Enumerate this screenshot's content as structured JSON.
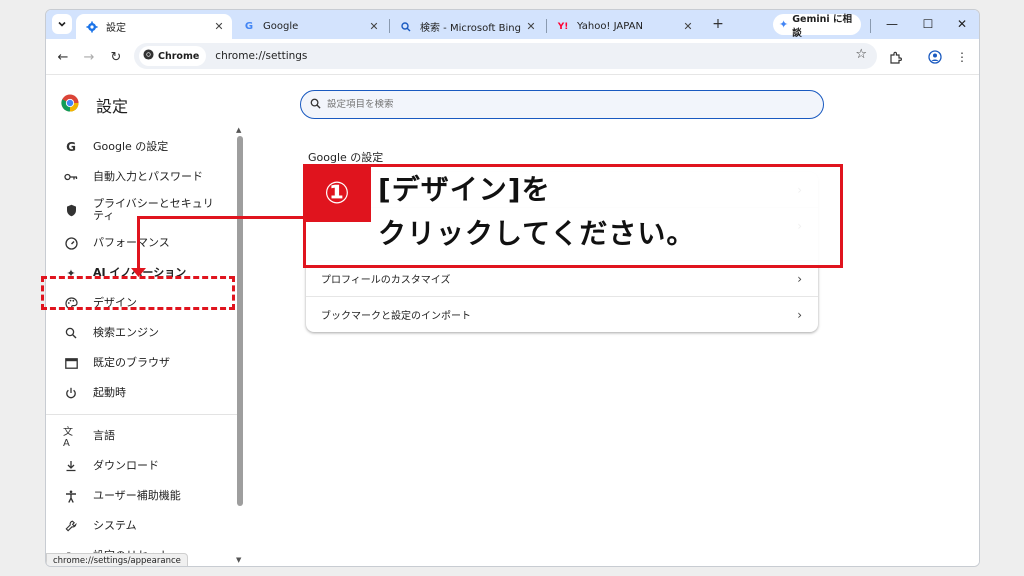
{
  "tabs": [
    {
      "label": "設定",
      "icon": "gear-icon",
      "active": true
    },
    {
      "label": "Google",
      "icon": "google-icon"
    },
    {
      "label": "検索 - Microsoft Bing",
      "icon": "search-icon"
    },
    {
      "label": "Yahoo! JAPAN",
      "icon": "yahoo-icon"
    }
  ],
  "gemini_label": "Gemini に相談",
  "omnibox": {
    "chip": "Chrome",
    "url": "chrome://settings"
  },
  "settings_title": "設定",
  "search": {
    "placeholder": "設定項目を検索"
  },
  "sidebar": {
    "items": [
      {
        "label": "Google の設定",
        "icon": "google-g-icon"
      },
      {
        "label": "自動入力とパスワード",
        "icon": "key-icon"
      },
      {
        "label": "プライバシーとセキュリティ",
        "icon": "shield-icon"
      },
      {
        "label": "パフォーマンス",
        "icon": "speedometer-icon"
      },
      {
        "label": "AI イノベーション",
        "icon": "sparkle-icon"
      },
      {
        "label": "デザイン",
        "icon": "palette-icon"
      },
      {
        "label": "検索エンジン",
        "icon": "search-icon"
      },
      {
        "label": "既定のブラウザ",
        "icon": "browser-window-icon"
      },
      {
        "label": "起動時",
        "icon": "power-icon"
      },
      {
        "label": "言語",
        "icon": "translate-icon"
      },
      {
        "label": "ダウンロード",
        "icon": "download-icon"
      },
      {
        "label": "ユーザー補助機能",
        "icon": "accessibility-icon"
      },
      {
        "label": "システム",
        "icon": "wrench-icon"
      },
      {
        "label": "設定のリセット",
        "icon": "reset-icon"
      }
    ]
  },
  "main": {
    "section_title": "Google の設定",
    "rows": [
      {
        "label": ""
      },
      {
        "label": ""
      },
      {
        "label": "プロフィールのカスタマイズ"
      },
      {
        "label": "ブックマークと設定のインポート"
      }
    ]
  },
  "status_url": "chrome://settings/appearance",
  "annotation": {
    "number": "①",
    "line1": "[デザイン]を",
    "line2": "クリックしてください。"
  },
  "colors": {
    "accent": "#1a5ac0",
    "annotation_red": "#e0141e",
    "tabstrip": "#d3e3fd"
  }
}
